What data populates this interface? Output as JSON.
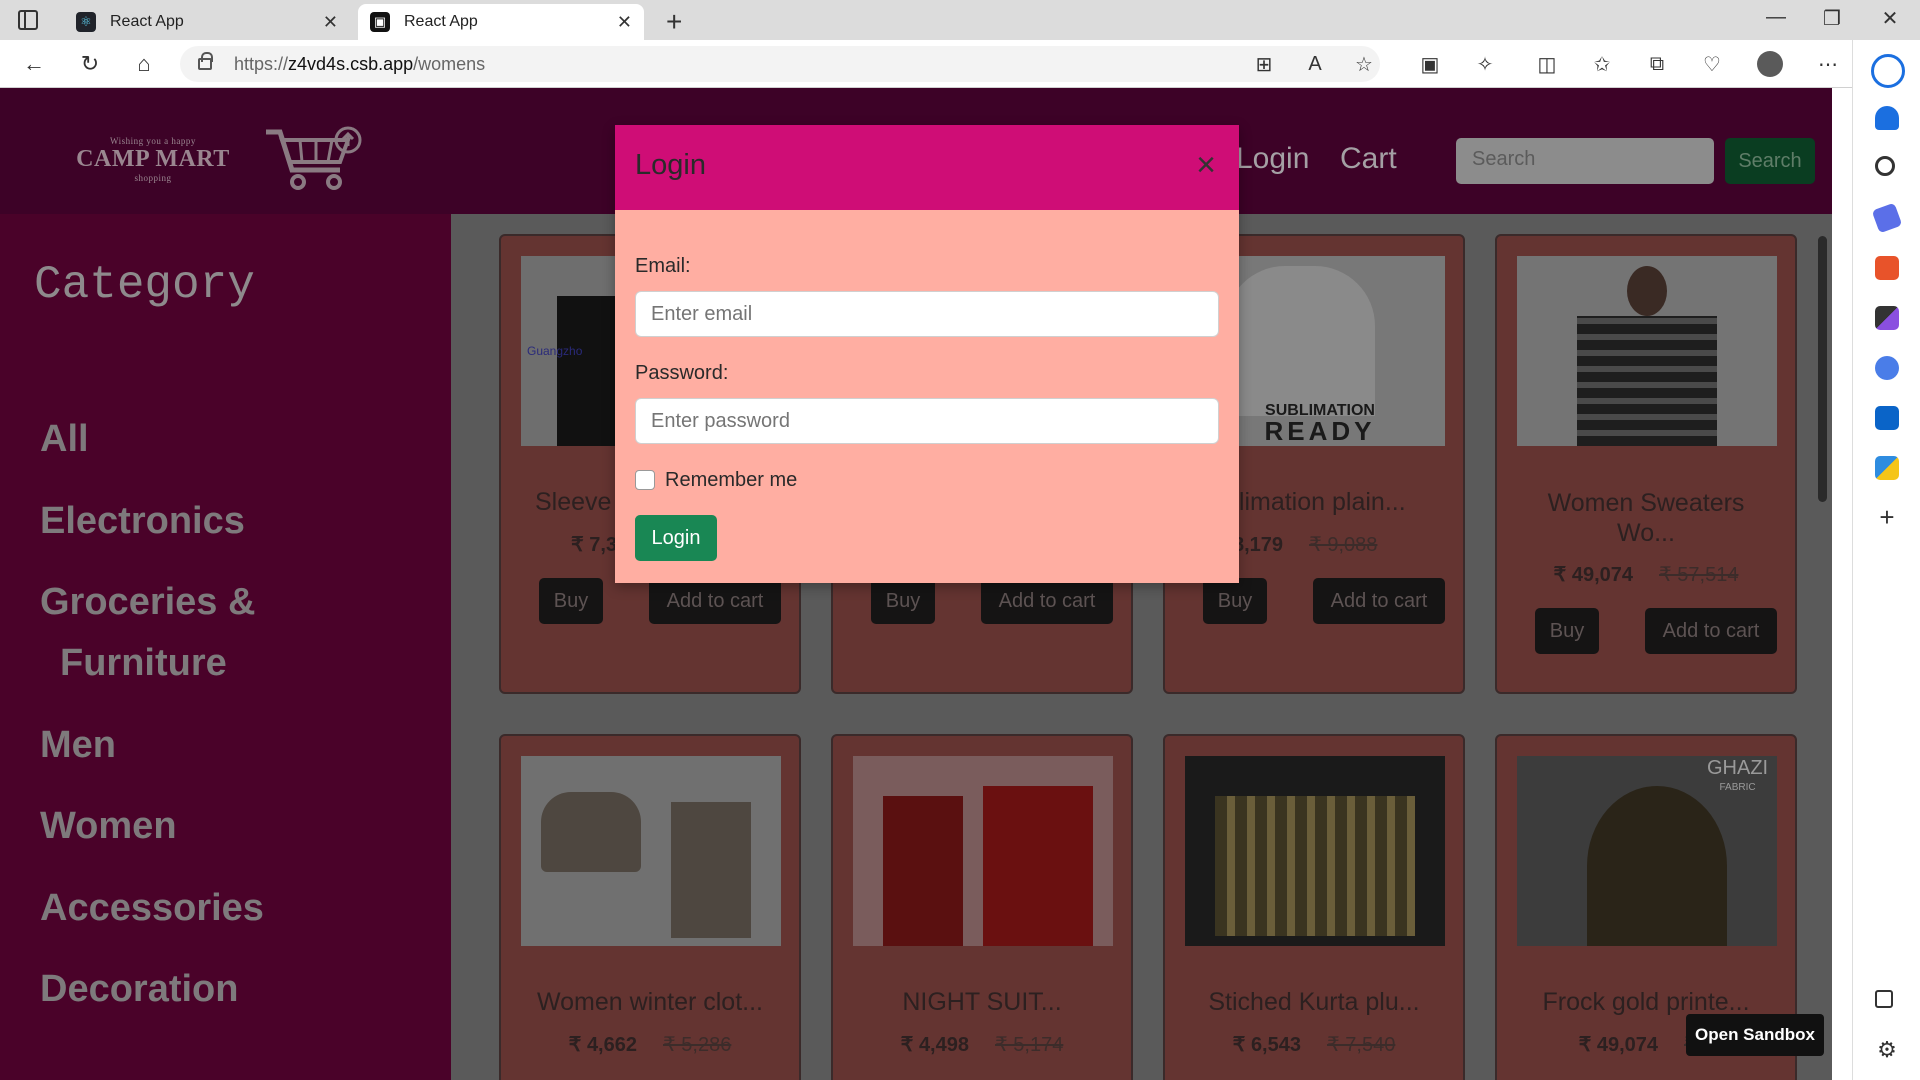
{
  "browser": {
    "tabs": [
      {
        "title": "React App",
        "active": false
      },
      {
        "title": "React App",
        "active": true
      }
    ],
    "url": {
      "scheme": "https://",
      "host": "z4vd4s.csb.app",
      "path": "/womens"
    }
  },
  "header": {
    "logo_text": "CAMP MART",
    "logo_tagline_top": "Wishing you a happy",
    "logo_tagline_bottom": "shopping",
    "nav": [
      "Login",
      "Cart"
    ],
    "search_placeholder": "Search",
    "search_button": "Search"
  },
  "sidebar": {
    "heading": "Category",
    "items": [
      "All",
      "Electronics",
      "Groceries &",
      "Furniture",
      "Men",
      "Women",
      "Accessories",
      "Decoration"
    ]
  },
  "products": [
    {
      "title": "Sleeve",
      "price": "₹ 7,3",
      "was": "",
      "buy": "Buy",
      "cart": "Add to cart"
    },
    {
      "title": "",
      "price": "",
      "was": "",
      "buy": "Buy",
      "cart": "Add to cart"
    },
    {
      "title": "blimation plain...",
      "price": "8,179",
      "was": "₹ 9,088",
      "buy": "Buy",
      "cart": "Add to cart"
    },
    {
      "title_line1": "Women Sweaters",
      "title_line2": "Wo...",
      "price": "₹ 49,074",
      "was": "₹ 57,514",
      "buy": "Buy",
      "cart": "Add to cart"
    },
    {
      "title": "Women winter clot...",
      "price": "₹ 4,662",
      "was": "₹ 5,286"
    },
    {
      "title": "NIGHT SUIT...",
      "price": "₹ 4,498",
      "was": "₹ 5,174"
    },
    {
      "title": "Stiched Kurta plu...",
      "price": "₹ 6,543",
      "was": "₹ 7,540"
    },
    {
      "title": "Frock gold printe...",
      "price": "₹ 49,074",
      "was": "₹ 5"
    }
  ],
  "product_images": {
    "card1_brand_text": "Guangzho",
    "card3_print_text_1": "SUBLIMATION",
    "card3_print_text_2": "READY",
    "card8_label_1": "GHAZI",
    "card8_label_2": "FABRIC"
  },
  "modal": {
    "title": "Login",
    "email_label": "Email:",
    "email_placeholder": "Enter email",
    "password_label": "Password:",
    "password_placeholder": "Enter password",
    "remember_label": "Remember me",
    "submit_label": "Login"
  },
  "open_sandbox": "Open Sandbox"
}
